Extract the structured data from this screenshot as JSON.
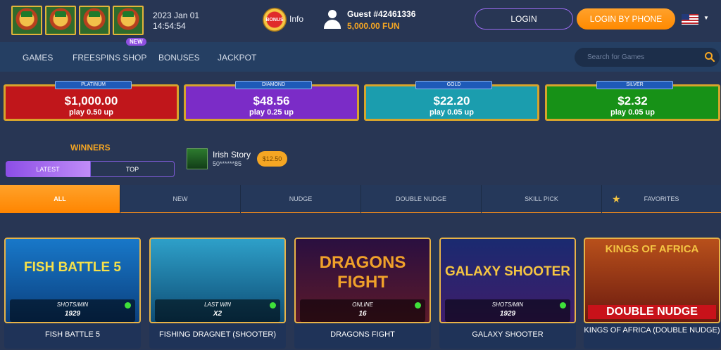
{
  "header": {
    "date": "2023 Jan 01",
    "time": "14:54:54",
    "bonus_badge": "BONUS",
    "info_label": "Info",
    "guest_name": "Guest #42461336",
    "guest_balance": "5,000.00 FUN",
    "login_label": "LOGIN",
    "login_phone_label": "LOGIN BY PHONE",
    "icons": [
      "leprechaun-logo-icon",
      "bonus-icon",
      "user-icon",
      "us-flag-icon",
      "chevron-down-icon"
    ]
  },
  "nav": {
    "items": [
      {
        "label": "GAMES"
      },
      {
        "label": "FREESPINS SHOP"
      },
      {
        "label": "BONUSES"
      },
      {
        "label": "JACKPOT"
      }
    ],
    "new_badge": "NEW",
    "search_placeholder": "Search for Games"
  },
  "jackpots": [
    {
      "tier": "PLATINUM",
      "amount": "$1,000.00",
      "play": "play 0.50 up",
      "color": "#c0161b"
    },
    {
      "tier": "DIAMOND",
      "amount": "$48.56",
      "play": "play 0.25 up",
      "color": "#7b2cc7"
    },
    {
      "tier": "GOLD",
      "amount": "$22.20",
      "play": "play 0.05 up",
      "color": "#1b9dae"
    },
    {
      "tier": "SILVER",
      "amount": "$2.32",
      "play": "play 0.05 up",
      "color": "#179117"
    }
  ],
  "winners": {
    "title": "WINNERS",
    "tabs": [
      "LATEST",
      "TOP"
    ],
    "latest": {
      "game": "Irish Story",
      "user": "50******85",
      "amount": "$12.50"
    }
  },
  "categories": [
    {
      "label": "ALL"
    },
    {
      "label": "NEW"
    },
    {
      "label": "NUDGE"
    },
    {
      "label": "DOUBLE NUDGE"
    },
    {
      "label": "SKILL PICK"
    },
    {
      "label": "FAVORITES"
    }
  ],
  "games": [
    {
      "name": "FISH BATTLE 5",
      "art_title": "FISH BATTLE 5",
      "stat_label": "SHOTS/MIN",
      "stat_value": "1929"
    },
    {
      "name": "FISHING DRAGNET (SHOOTER)",
      "art_title": "",
      "stat_label": "LAST WIN",
      "stat_value": "X2"
    },
    {
      "name": "DRAGONS FIGHT",
      "art_title": "DRAGONS FIGHT",
      "stat_label": "ONLINE",
      "stat_value": "16"
    },
    {
      "name": "GALAXY SHOOTER",
      "art_title": "GALAXY SHOOTER",
      "stat_label": "SHOTS/MIN",
      "stat_value": "1929"
    },
    {
      "name": "KINGS OF AFRICA (DOUBLE NUDGE)",
      "art_title": "KINGS OF AFRICA",
      "banner": "DOUBLE NUDGE"
    }
  ],
  "colors": {
    "accent": "#ff8a00",
    "balance": "#f5a623",
    "background": "#283654"
  }
}
